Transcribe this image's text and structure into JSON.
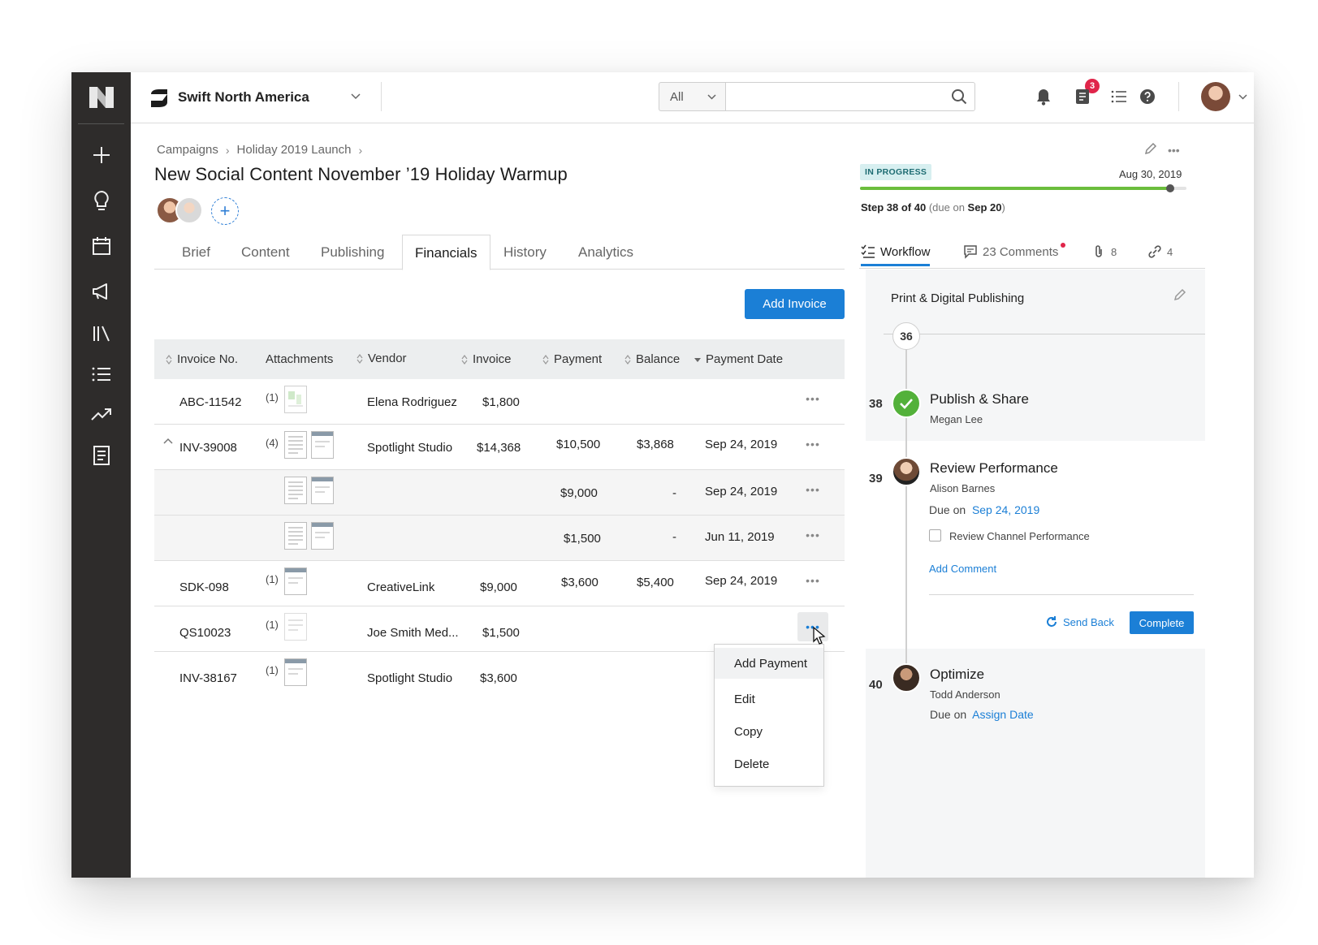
{
  "org": {
    "name": "Swift North America"
  },
  "search": {
    "scope": "All",
    "placeholder": ""
  },
  "notifications": {
    "count": "3"
  },
  "breadcrumb": [
    "Campaigns",
    "Holiday 2019 Launch"
  ],
  "page": {
    "title": "New Social Content November ’19 Holiday Warmup",
    "add_member": "+"
  },
  "tabs": [
    "Brief",
    "Content",
    "Publishing",
    "Financials",
    "History",
    "Analytics"
  ],
  "active_tab": "Financials",
  "add_invoice_label": "Add Invoice",
  "table": {
    "headers": [
      "Invoice No.",
      "Attachments",
      "Vendor",
      "Invoice",
      "Payment",
      "Balance",
      "Payment Date"
    ],
    "rows": [
      {
        "invoice_no": "ABC-11542",
        "att": "(1)",
        "vendor": "Elena Rodriguez",
        "invoice": "$1,800",
        "payment": "",
        "balance": "",
        "date": ""
      },
      {
        "invoice_no": "INV-39008",
        "att": "(4)",
        "vendor": "Spotlight Studio",
        "invoice": "$14,368",
        "payment": "$10,500",
        "balance": "$3,868",
        "date": "Sep 24, 2019"
      },
      {
        "invoice_no": "",
        "att": "",
        "vendor": "",
        "invoice": "",
        "payment": "$9,000",
        "balance": "-",
        "date": "Sep 24, 2019"
      },
      {
        "invoice_no": "",
        "att": "",
        "vendor": "",
        "invoice": "",
        "payment": "$1,500",
        "balance": "-",
        "date": "Jun 11, 2019"
      },
      {
        "invoice_no": "SDK-098",
        "att": "(1)",
        "vendor": "CreativeLink",
        "invoice": "$9,000",
        "payment": "$3,600",
        "balance": "$5,400",
        "date": "Sep 24, 2019"
      },
      {
        "invoice_no": "QS10023",
        "att": "(1)",
        "vendor": "Joe Smith Med...",
        "invoice": "$1,500",
        "payment": "",
        "balance": "",
        "date": ""
      },
      {
        "invoice_no": "INV-38167",
        "att": "(1)",
        "vendor": "Spotlight Studio",
        "invoice": "$3,600",
        "payment": "",
        "balance": "",
        "date": ""
      }
    ],
    "row_menu": "•••"
  },
  "row_actions": [
    "Add Payment",
    "Edit",
    "Copy",
    "Delete"
  ],
  "status": {
    "badge": "IN PROGRESS",
    "due": "Aug 30, 2019",
    "progress": 0.95,
    "step_label": "Step 38 of 40",
    "due_on_label": "(due on",
    "due_on_date": "Sep 20",
    "due_close": ")"
  },
  "right_tabs": {
    "workflow": "Workflow",
    "comments": "23 Comments",
    "attachments": "8",
    "links": "4"
  },
  "workflow": {
    "title": "Print & Digital Publishing",
    "current_marker": "36",
    "steps": [
      {
        "num": "38",
        "title": "Publish & Share",
        "assignee": "Megan Lee"
      },
      {
        "num": "39",
        "title": "Review Performance",
        "assignee": "Alison Barnes",
        "due_label": "Due on",
        "due_date": "Sep 24, 2019",
        "checklist": "Review Channel Performance",
        "add_comment": "Add Comment",
        "send_back": "Send Back",
        "complete": "Complete"
      },
      {
        "num": "40",
        "title": "Optimize",
        "assignee": "Todd Anderson",
        "due_label": "Due on",
        "due_date": "Assign Date"
      }
    ]
  },
  "colors": {
    "accent": "#1b7fd6",
    "success": "#53b13a",
    "badge_bg": "#d7eff0",
    "rail": "#2e2c2b"
  }
}
